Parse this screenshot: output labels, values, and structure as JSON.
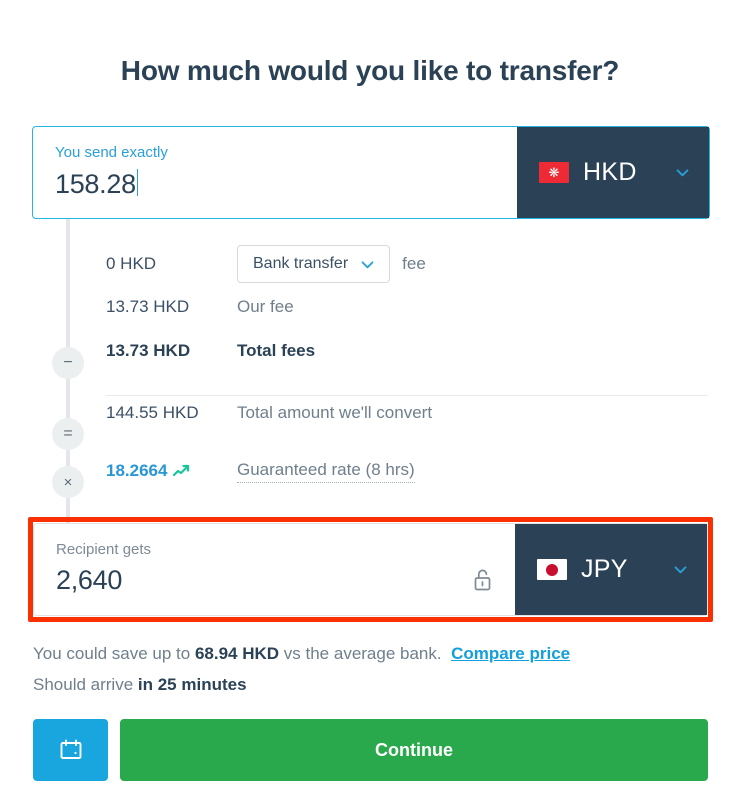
{
  "page": {
    "title": "How much would you like to transfer?"
  },
  "send": {
    "label": "You send exactly",
    "amount": "158.28",
    "currency": {
      "code": "HKD",
      "flag": "hong-kong-flag",
      "chevron": "chevron-down-icon"
    }
  },
  "breakdown": {
    "payin": {
      "amount": "0 HKD",
      "method": "Bank transfer",
      "suffix": "fee",
      "operator": ""
    },
    "our_fee": {
      "amount": "13.73 HKD",
      "label": "Our fee",
      "operator": ""
    },
    "total_fees": {
      "amount": "13.73 HKD",
      "label": "Total fees",
      "operator": "−"
    },
    "convert": {
      "amount": "144.55 HKD",
      "label": "Total amount we'll convert",
      "operator": "="
    },
    "rate": {
      "value": "18.2664",
      "trend_icon": "trend-up-arrow-icon",
      "label": "Guaranteed rate (8 hrs)",
      "operator": "×"
    }
  },
  "receive": {
    "label": "Recipient gets",
    "amount": "2,640",
    "lock_icon": "unlock-icon",
    "currency": {
      "code": "JPY",
      "flag": "japan-flag",
      "chevron": "chevron-down-icon"
    }
  },
  "notes": {
    "savings_prefix": "You could save up to ",
    "savings_amount": "68.94 HKD",
    "savings_suffix": " vs the average bank.",
    "compare_link": "Compare price",
    "arrival_prefix": "Should arrive ",
    "arrival_time": "in 25 minutes"
  },
  "actions": {
    "schedule_icon": "calendar-icon",
    "continue_label": "Continue"
  },
  "colors": {
    "brand_navy": "#2b4256",
    "brand_blue": "#29a0da",
    "green": "#2aa84c",
    "annotation_red": "#fa3000",
    "trend_green": "#16c79a"
  }
}
